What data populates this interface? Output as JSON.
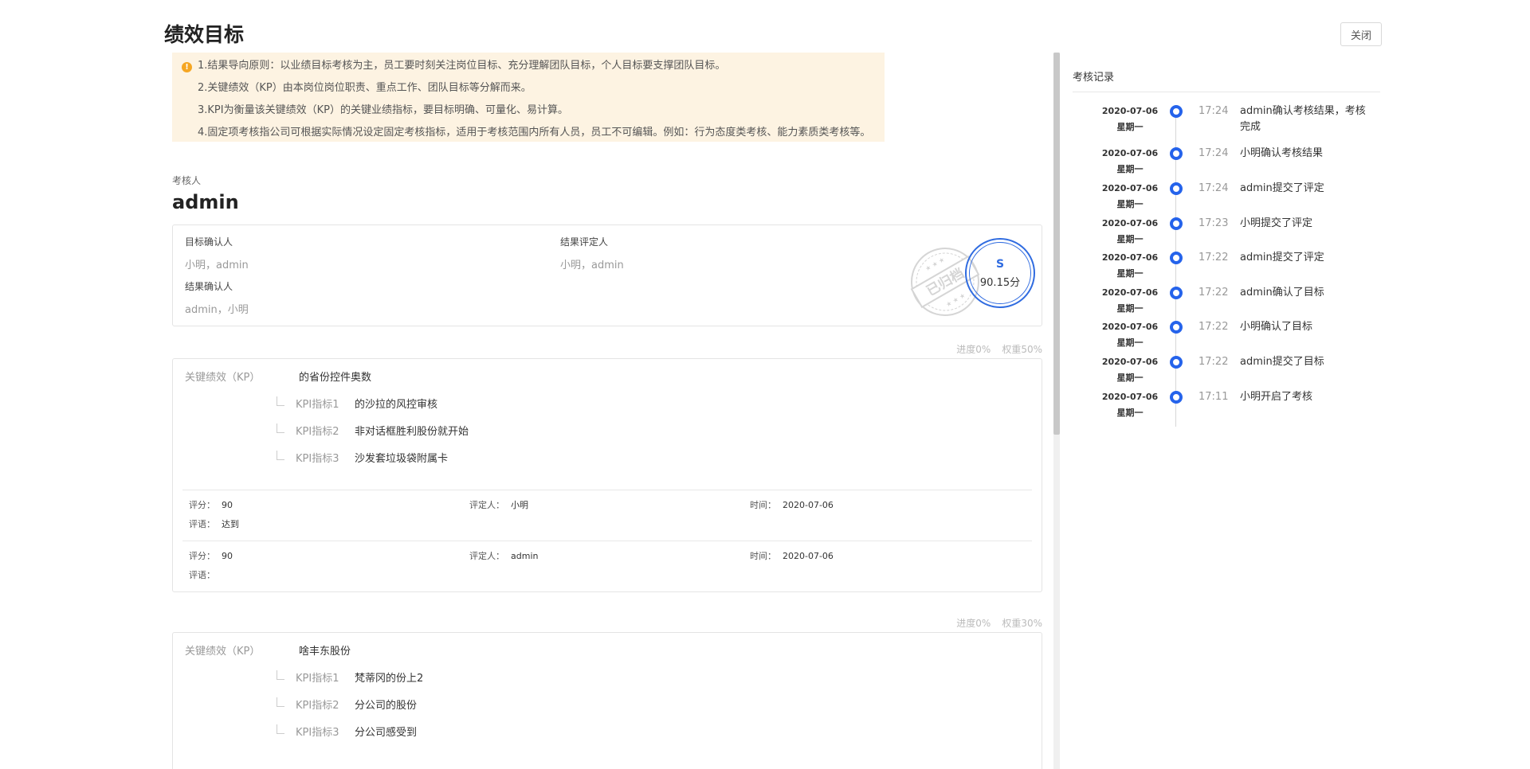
{
  "page": {
    "title": "绩效目标",
    "close_label": "关闭"
  },
  "notice": {
    "icon": "warning-icon",
    "lines": [
      "1.结果导向原则：以业绩目标考核为主，员工要时刻关注岗位目标、充分理解团队目标，个人目标要支撑团队目标。",
      "2.关键绩效（KP）由本岗位岗位职责、重点工作、团队目标等分解而来。",
      "3.KPI为衡量该关键绩效（KP）的关键业绩指标，要目标明确、可量化、易计算。",
      "4.固定项考核指公司可根据实际情况设定固定考核指标，适用于考核范围内所有人员，员工不可编辑。例如：行为态度类考核、能力素质类考核等。"
    ]
  },
  "reviewer": {
    "label": "考核人",
    "name": "admin"
  },
  "info": {
    "target_confirm_label": "目标确认人",
    "target_confirm_value": "小明，admin",
    "result_rater_label": "结果评定人",
    "result_rater_value": "小明，admin",
    "result_confirm_label": "结果确认人",
    "result_confirm_value": "admin，小明",
    "stamp_text": "已归档",
    "score_grade": "S",
    "score_value": "90.15分"
  },
  "kp_cards": [
    {
      "progress": "进度0%",
      "weight": "权重50%",
      "head_label": "关键绩效（KP）",
      "title": "的省份控件奥数",
      "kpis": [
        {
          "label": "KPI指标1",
          "text": "的沙拉的风控审核"
        },
        {
          "label": "KPI指标2",
          "text": "非对话框胜利股份就开始"
        },
        {
          "label": "KPI指标3",
          "text": "沙发套垃圾袋附属卡"
        }
      ],
      "evaluations": [
        {
          "score_label": "评分：",
          "score": "90",
          "rater_label": "评定人：",
          "rater": "小明",
          "time_label": "时间：",
          "time": "2020-07-06",
          "comment_label": "评语：",
          "comment": "达到"
        },
        {
          "score_label": "评分：",
          "score": "90",
          "rater_label": "评定人：",
          "rater": "admin",
          "time_label": "时间：",
          "time": "2020-07-06",
          "comment_label": "评语：",
          "comment": ""
        }
      ]
    },
    {
      "progress": "进度0%",
      "weight": "权重30%",
      "head_label": "关键绩效（KP）",
      "title": "啥丰东股份",
      "kpis": [
        {
          "label": "KPI指标1",
          "text": "梵蒂冈的份上2"
        },
        {
          "label": "KPI指标2",
          "text": "分公司的股份"
        },
        {
          "label": "KPI指标3",
          "text": "分公司感受到"
        }
      ]
    }
  ],
  "timeline": {
    "title": "考核记录",
    "items": [
      {
        "date": "2020-07-06",
        "weekday": "星期一",
        "time": "17:24",
        "text": "admin确认考核结果，考核完成"
      },
      {
        "date": "2020-07-06",
        "weekday": "星期一",
        "time": "17:24",
        "text": "小明确认考核结果"
      },
      {
        "date": "2020-07-06",
        "weekday": "星期一",
        "time": "17:24",
        "text": "admin提交了评定"
      },
      {
        "date": "2020-07-06",
        "weekday": "星期一",
        "time": "17:23",
        "text": "小明提交了评定"
      },
      {
        "date": "2020-07-06",
        "weekday": "星期一",
        "time": "17:22",
        "text": "admin提交了评定"
      },
      {
        "date": "2020-07-06",
        "weekday": "星期一",
        "time": "17:22",
        "text": "admin确认了目标"
      },
      {
        "date": "2020-07-06",
        "weekday": "星期一",
        "time": "17:22",
        "text": "小明确认了目标"
      },
      {
        "date": "2020-07-06",
        "weekday": "星期一",
        "time": "17:22",
        "text": "admin提交了目标"
      },
      {
        "date": "2020-07-06",
        "weekday": "星期一",
        "time": "17:11",
        "text": "小明开启了考核"
      }
    ]
  },
  "colors": {
    "accent": "#2f6be0",
    "notice_bg": "#fdf3e2",
    "warning": "#f5a623"
  }
}
